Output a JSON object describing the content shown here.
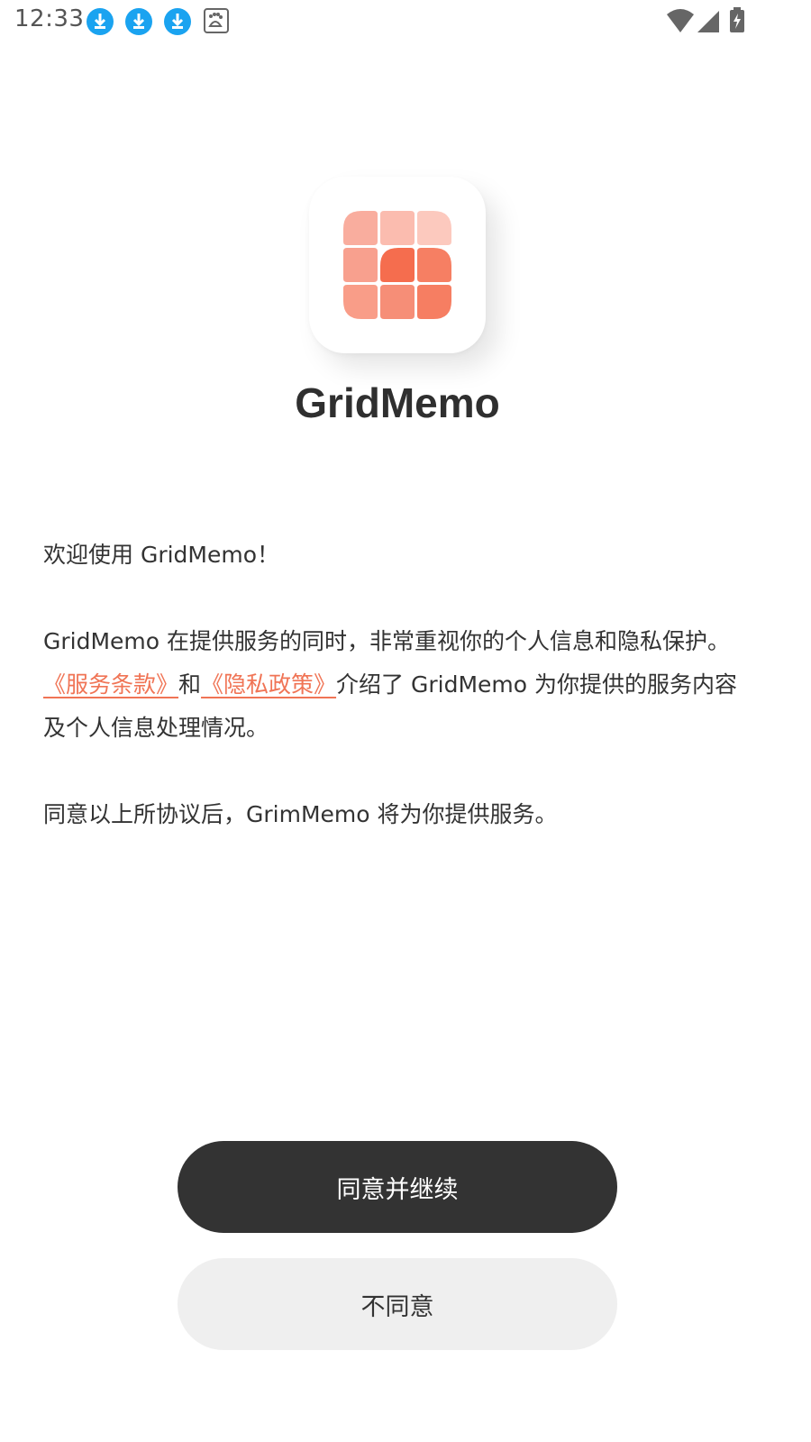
{
  "status_bar": {
    "time": "12:33",
    "notifications": [
      "download-icon",
      "download-icon",
      "download-icon",
      "baidu-icon"
    ],
    "icons": [
      "wifi-icon",
      "cellular-signal-icon",
      "battery-charging-icon"
    ]
  },
  "app": {
    "name": "GridMemo",
    "logo_colors": [
      "#f9ad9e",
      "#fbbcaf",
      "#fcc9be",
      "#f8a08e",
      "#f56d4e",
      "#f67f63",
      "#f99d88",
      "#f68e77",
      "#f67e62"
    ]
  },
  "content": {
    "welcome": "欢迎使用 GridMemo！",
    "para_part1": "GridMemo 在提供服务的同时，非常重视你的个人信息和隐私保护。",
    "terms_link": "《服务条款》",
    "conjunction": "和",
    "privacy_link": "《隐私政策》",
    "para_part2": "介绍了 GridMemo 为你提供的服务内容及个人信息处理情况。",
    "consent": "同意以上所协议后，GrimMemo 将为你提供服务。"
  },
  "buttons": {
    "agree_label": "同意并继续",
    "disagree_label": "不同意"
  },
  "colors": {
    "link": "#f07455",
    "primary_button": "#333333",
    "secondary_button": "#efefef"
  }
}
